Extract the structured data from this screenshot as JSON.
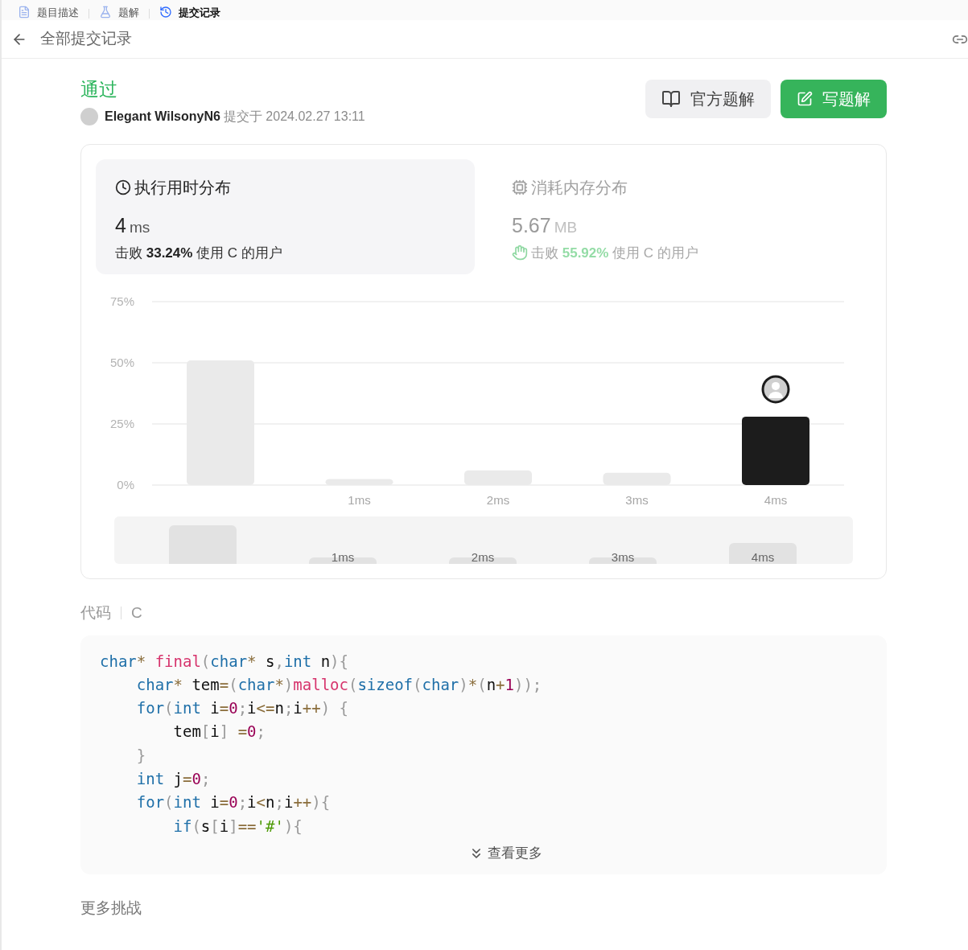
{
  "top_tabs": [
    {
      "label": "题目描述",
      "selected": false,
      "kind": "description"
    },
    {
      "label": "题解",
      "selected": false,
      "kind": "solutions"
    },
    {
      "label": "提交记录",
      "selected": true,
      "kind": "submissions"
    }
  ],
  "header": {
    "back_label": "全部提交记录"
  },
  "submission": {
    "status": "通过",
    "user": "Elegant WilsonyN6",
    "submitted_label": "提交于",
    "time": "2024.02.27 13:11"
  },
  "buttons": [
    {
      "label": "官方题解",
      "kind": "secondary"
    },
    {
      "label": "写题解",
      "kind": "primary"
    }
  ],
  "stats": [
    {
      "title": "执行用时分布",
      "selected": true,
      "kind": "time",
      "value": "4",
      "unit": "ms",
      "beat_label": "击败",
      "percent": "33.24%",
      "suffix": "使用 C 的用户"
    },
    {
      "title": "消耗内存分布",
      "selected": false,
      "kind": "memory",
      "value": "5.67",
      "unit": "MB",
      "beat_label": "击败",
      "percent": "55.92%",
      "suffix": "使用 C 的用户"
    }
  ],
  "chart_data": {
    "type": "bar",
    "categories": [
      null,
      "1ms",
      "2ms",
      "3ms",
      "4ms"
    ],
    "ylim": [
      0,
      75
    ],
    "yticks": [
      {
        "value": 0,
        "label": "0%"
      },
      {
        "value": 25,
        "label": "25%"
      },
      {
        "value": 50,
        "label": "50%"
      },
      {
        "value": 75,
        "label": "75%"
      }
    ],
    "series": [
      {
        "color": "#eaeaea",
        "values": [
          51,
          2.5,
          6,
          5,
          null
        ]
      },
      {
        "color": "#1c1c1c",
        "values": [
          null,
          null,
          null,
          null,
          28
        ]
      }
    ]
  },
  "overview": {
    "labels": [
      "1ms",
      "2ms",
      "3ms",
      "4ms"
    ]
  },
  "code": {
    "label": "代码",
    "language": "C",
    "more": "查看更多",
    "lines": [
      [
        {
          "t": "char",
          "kind": "type"
        },
        {
          "t": "* ",
          "kind": "op"
        },
        {
          "t": "final",
          "kind": "fn"
        },
        {
          "t": "(",
          "kind": "punct"
        },
        {
          "t": "char",
          "kind": "type"
        },
        {
          "t": "*",
          "kind": "op"
        },
        {
          "t": " s",
          "kind": "plain"
        },
        {
          "t": ",",
          "kind": "punct"
        },
        {
          "t": "int",
          "kind": "type"
        },
        {
          "t": " n",
          "kind": "plain"
        },
        {
          "t": "){",
          "kind": "punct"
        }
      ],
      [
        {
          "t": "    char",
          "kind": "type"
        },
        {
          "t": "*",
          "kind": "op"
        },
        {
          "t": " tem",
          "kind": "plain"
        },
        {
          "t": "=",
          "kind": "op"
        },
        {
          "t": "(",
          "kind": "punct"
        },
        {
          "t": "char",
          "kind": "type"
        },
        {
          "t": "*",
          "kind": "op"
        },
        {
          "t": ")",
          "kind": "punct"
        },
        {
          "t": "malloc",
          "kind": "fn"
        },
        {
          "t": "(",
          "kind": "punct"
        },
        {
          "t": "sizeof",
          "kind": "type"
        },
        {
          "t": "(",
          "kind": "punct"
        },
        {
          "t": "char",
          "kind": "type"
        },
        {
          "t": ")",
          "kind": "punct"
        },
        {
          "t": "*",
          "kind": "op"
        },
        {
          "t": "(",
          "kind": "punct"
        },
        {
          "t": "n",
          "kind": "plain"
        },
        {
          "t": "+",
          "kind": "op"
        },
        {
          "t": "1",
          "kind": "num"
        },
        {
          "t": "));",
          "kind": "punct"
        }
      ],
      [
        {
          "t": "    for",
          "kind": "type"
        },
        {
          "t": "(",
          "kind": "punct"
        },
        {
          "t": "int",
          "kind": "type"
        },
        {
          "t": " i",
          "kind": "plain"
        },
        {
          "t": "=",
          "kind": "op"
        },
        {
          "t": "0",
          "kind": "num"
        },
        {
          "t": ";",
          "kind": "punct"
        },
        {
          "t": "i",
          "kind": "plain"
        },
        {
          "t": "<=",
          "kind": "op"
        },
        {
          "t": "n",
          "kind": "plain"
        },
        {
          "t": ";",
          "kind": "punct"
        },
        {
          "t": "i",
          "kind": "plain"
        },
        {
          "t": "++",
          "kind": "op"
        },
        {
          "t": ") {",
          "kind": "punct"
        }
      ],
      [
        {
          "t": "        tem",
          "kind": "plain"
        },
        {
          "t": "[",
          "kind": "punct"
        },
        {
          "t": "i",
          "kind": "plain"
        },
        {
          "t": "] ",
          "kind": "punct"
        },
        {
          "t": "=",
          "kind": "op"
        },
        {
          "t": "0",
          "kind": "num"
        },
        {
          "t": ";",
          "kind": "punct"
        }
      ],
      [
        {
          "t": "    }",
          "kind": "punct"
        }
      ],
      [
        {
          "t": "    int",
          "kind": "type"
        },
        {
          "t": " j",
          "kind": "plain"
        },
        {
          "t": "=",
          "kind": "op"
        },
        {
          "t": "0",
          "kind": "num"
        },
        {
          "t": ";",
          "kind": "punct"
        }
      ],
      [
        {
          "t": "    for",
          "kind": "type"
        },
        {
          "t": "(",
          "kind": "punct"
        },
        {
          "t": "int",
          "kind": "type"
        },
        {
          "t": " i",
          "kind": "plain"
        },
        {
          "t": "=",
          "kind": "op"
        },
        {
          "t": "0",
          "kind": "num"
        },
        {
          "t": ";",
          "kind": "punct"
        },
        {
          "t": "i",
          "kind": "plain"
        },
        {
          "t": "<",
          "kind": "op"
        },
        {
          "t": "n",
          "kind": "plain"
        },
        {
          "t": ";",
          "kind": "punct"
        },
        {
          "t": "i",
          "kind": "plain"
        },
        {
          "t": "++",
          "kind": "op"
        },
        {
          "t": "){",
          "kind": "punct"
        }
      ],
      [
        {
          "t": "        if",
          "kind": "type"
        },
        {
          "t": "(",
          "kind": "punct"
        },
        {
          "t": "s",
          "kind": "plain"
        },
        {
          "t": "[",
          "kind": "punct"
        },
        {
          "t": "i",
          "kind": "plain"
        },
        {
          "t": "]",
          "kind": "punct"
        },
        {
          "t": "==",
          "kind": "op"
        },
        {
          "t": "'#'",
          "kind": "str"
        },
        {
          "t": "){",
          "kind": "punct"
        }
      ]
    ]
  },
  "more_challenges": "更多挑战"
}
